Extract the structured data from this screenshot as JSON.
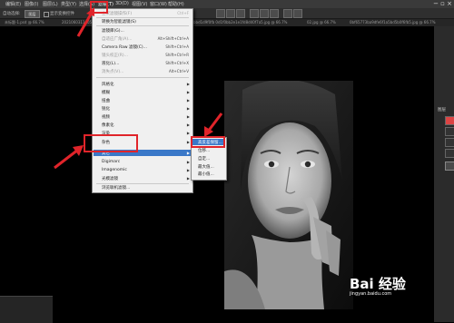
{
  "menubar": {
    "items": [
      "编辑(E)",
      "图像(I)",
      "图层(L)",
      "类型(Y)",
      "选择(S)",
      "滤镜(T)",
      "3D(D)",
      "视图(V)",
      "窗口(W)",
      "帮助(H)"
    ],
    "window_controls": "−  ▫  ×"
  },
  "options": {
    "auto_select_label": "自动选择:",
    "auto_select_value": "图层",
    "show_transform_label": "显示变换控件"
  },
  "tabs": [
    "未标题-1.psd @ 66.7%",
    "2021060311405.jpg @ 66.7%",
    "bbd1d9f0fb 0d1f0bb2e1e1fd8d40f7a5.jpg @ 66.7%",
    "02.jpg @ 66.7%",
    "0bf65773ba9dfe6f1a5bd5b0f6fb5.jpg @ 66.7%"
  ],
  "filter_menu": {
    "items": [
      {
        "label": "上次滤镜操作(F)",
        "shortcut": "Ctrl+F",
        "disabled": true
      },
      {
        "label": "转换为智能滤镜(S)",
        "disabled": false
      },
      {
        "label": "滤镜库(G)...",
        "disabled": false
      },
      {
        "label": "自适应广角(A)...",
        "shortcut": "Alt+Shift+Ctrl+A",
        "disabled": false
      },
      {
        "label": "Camera Raw 滤镜(C)...",
        "shortcut": "Shift+Ctrl+A",
        "disabled": false
      },
      {
        "label": "镜头校正(R)...",
        "shortcut": "Shift+Ctrl+R",
        "disabled": false
      },
      {
        "label": "液化(L)...",
        "shortcut": "Shift+Ctrl+X",
        "disabled": false
      },
      {
        "label": "消失点(V)...",
        "shortcut": "Alt+Ctrl+V",
        "disabled": false
      },
      {
        "label": "风格化",
        "submenu": true
      },
      {
        "label": "模糊",
        "submenu": true
      },
      {
        "label": "扭曲",
        "submenu": true
      },
      {
        "label": "锐化",
        "submenu": true
      },
      {
        "label": "视频",
        "submenu": true
      },
      {
        "label": "像素化",
        "submenu": true
      },
      {
        "label": "渲染",
        "submenu": true
      },
      {
        "label": "杂色",
        "submenu": true
      },
      {
        "label": "其它",
        "submenu": true
      },
      {
        "label": "Digimarc",
        "submenu": true
      },
      {
        "label": "Imagenomic",
        "submenu": true
      },
      {
        "label": "光模滤镜",
        "submenu": true
      },
      {
        "label": "浏览联机滤镜..."
      }
    ]
  },
  "submenu": {
    "items": [
      "高反差保留...",
      "位移...",
      "自定...",
      "最大值...",
      "最小值..."
    ]
  },
  "right_panel": {
    "label": "图层"
  },
  "watermark": {
    "text": "Bai 经验",
    "subtext": "jingyan.baidu.com"
  }
}
